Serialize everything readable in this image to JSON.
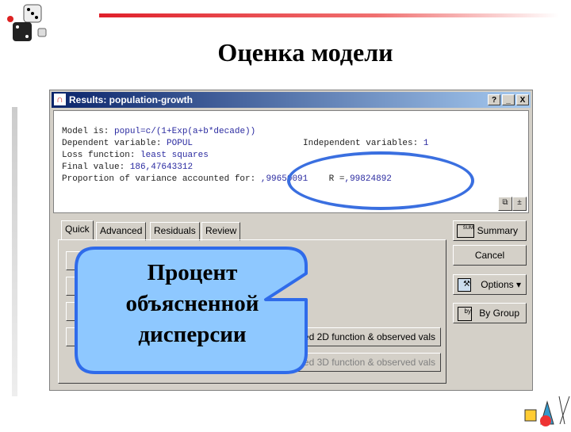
{
  "slide": {
    "title": "Оценка модели"
  },
  "window": {
    "title": "Results: population-growth",
    "help": "?",
    "minimize": "_",
    "close": "X"
  },
  "results": {
    "model_label": "Model is: ",
    "model_value": "popul=c/(1+Exp(a+b*decade))",
    "dep_label": "Dependent variable: ",
    "dep_value": "POPUL",
    "indep_label": "Independent variables: ",
    "indep_value": "1",
    "loss_label": "Loss function: ",
    "loss_value": "least squares",
    "final_label": "Final value: ",
    "final_value": "186,47643312",
    "prop_label": "Proportion of variance accounted for: ",
    "prop_value": ",99650091",
    "r_label": "R =",
    "r_value": ",99824892"
  },
  "tabs": [
    "Quick",
    "Advanced",
    "Residuals",
    "Review"
  ],
  "panel_buttons": [
    "ed 2D function & observed vals",
    "ed 3D function & observed vals"
  ],
  "side_buttons": {
    "summary": "Summary",
    "cancel": "Cancel",
    "options": "Options ▾",
    "by_group": "By Group"
  },
  "callout": {
    "line1": "Процент",
    "line2": "объясненной",
    "line3": "дисперсии"
  },
  "colors": {
    "highlight": "#3a6fe0",
    "callout_fill": "#8ec8ff"
  }
}
